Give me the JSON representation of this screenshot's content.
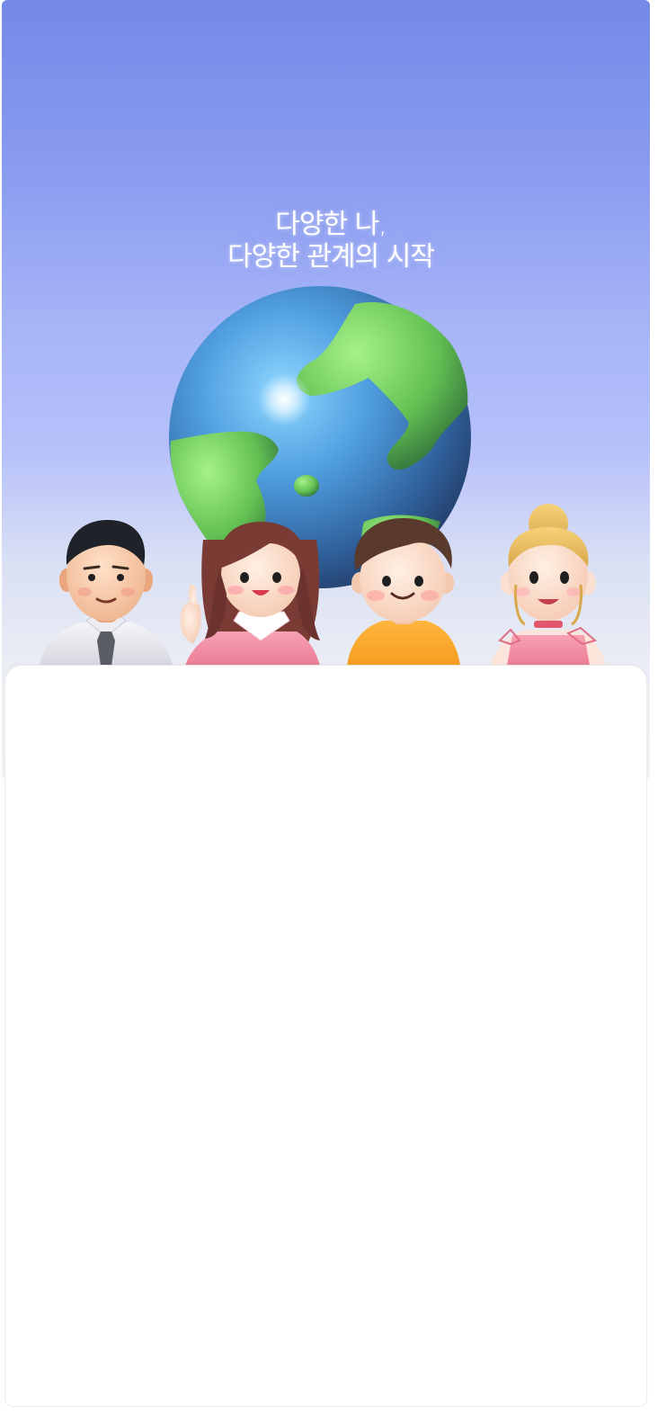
{
  "hero": {
    "headline_line1": "다양한 나,",
    "headline_line2": "다양한 관계의 시작"
  },
  "illustration": {
    "globe_icon": "earth-globe",
    "characters": [
      "man-in-shirt-and-tie",
      "girl-in-pink-dress",
      "boy-in-orange-shirt",
      "woman-with-blonde-bun"
    ]
  },
  "colors": {
    "gradient_top": "#7489e8",
    "gradient_bottom": "#f3f3f5",
    "sheet": "#ffffff"
  }
}
